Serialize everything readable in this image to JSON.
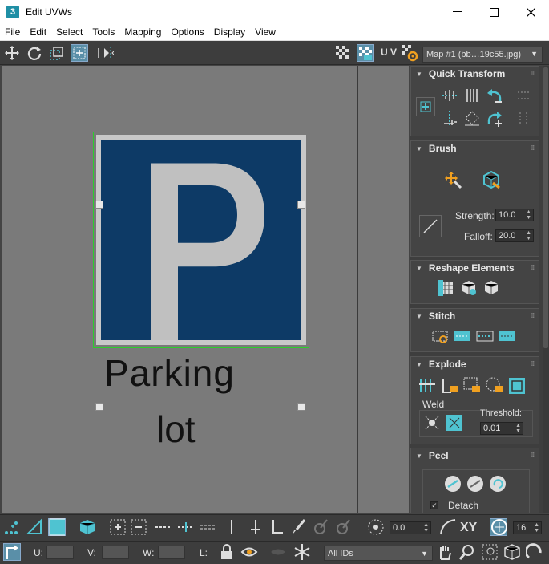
{
  "window": {
    "title": "Edit UVWs",
    "app_icon_glyph": "3"
  },
  "menu": [
    "File",
    "Edit",
    "Select",
    "Tools",
    "Mapping",
    "Options",
    "Display",
    "View"
  ],
  "toolbar_top": {
    "uv_label": "U V",
    "map_dropdown": "Map #1 (bb…19c55.jpg)"
  },
  "viewport": {
    "texture_text_1": "Parking",
    "texture_text_2": "lot"
  },
  "panel": {
    "quick_transform": {
      "title": "Quick Transform"
    },
    "brush": {
      "title": "Brush",
      "strength_label": "Strength:",
      "strength_value": "10.0",
      "falloff_label": "Falloff:",
      "falloff_value": "20.0"
    },
    "reshape": {
      "title": "Reshape Elements"
    },
    "stitch": {
      "title": "Stitch"
    },
    "explode": {
      "title": "Explode",
      "weld_label": "Weld",
      "threshold_label": "Threshold:",
      "threshold_value": "0.01"
    },
    "peel": {
      "title": "Peel",
      "detach_label": "Detach"
    }
  },
  "bottom1": {
    "angle_value": "0.0",
    "xy_label": "XY",
    "count_value": "16"
  },
  "bottom2": {
    "u_label": "U:",
    "v_label": "V:",
    "w_label": "W:",
    "l_label": "L:",
    "ids_dropdown": "All IDs"
  },
  "colors": {
    "accent": "#4fc3d1",
    "uv_green": "#2bd02b",
    "sign_blue": "#0d3a66"
  }
}
